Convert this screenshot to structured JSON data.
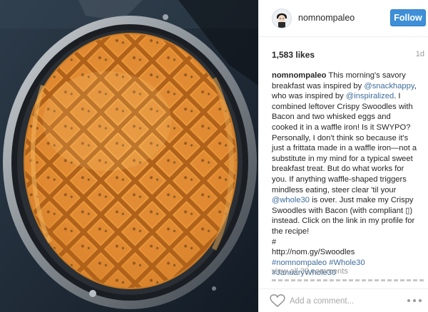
{
  "post": {
    "username": "nomnompaleo",
    "follow_label": "Follow",
    "likes": "1,583 likes",
    "age": "1d",
    "caption": {
      "user": "nomnompaleo",
      "l1": " This morning's savory",
      "l2": "breakfast was inspired by ",
      "l2_link": "@snackhappy",
      "l2_end": ",",
      "l3": "who was inspired by ",
      "l3_link": "@inspiralized",
      "l3_end": ". I",
      "l4": "combined leftover Crispy Swoodles with",
      "l5": "Bacon and two whisked eggs and",
      "l6": "cooked it in a waffle iron! Is it SWYPO?",
      "l7": "Personally, I don't think so because it's",
      "l8": "just a frittata made in a waffle iron—not a",
      "l9": "substitute in my mind for a typical sweet",
      "l10": "breakfast treat. But do what works for",
      "l11": "you. If anything waffle-shaped triggers",
      "l12": "mindless eating, steer clear 'til your",
      "l13_link": "@whole30",
      "l13": " is over. Just make my Crispy",
      "l14": "Swoodles with Bacon (with compliant ▯)",
      "l15": "instead. Click on the link in my profile for",
      "l16": "the recipe!",
      "l17": "#",
      "l18": "http://nom.gy/Swoodles",
      "l19a": "#nomnompaleo",
      "l19b": "#Whole30",
      "l20": "#JanuaryWhole30"
    },
    "view_comments": "view all 32 comments",
    "comment_placeholder": "Add a comment...",
    "icons": {
      "heart": "heart-icon",
      "more": "more-options-icon",
      "avatar": "profile-avatar"
    },
    "colors": {
      "follow_blue": "#3f8fd8",
      "link_blue": "#3e6d9d",
      "muted": "#999999"
    }
  }
}
